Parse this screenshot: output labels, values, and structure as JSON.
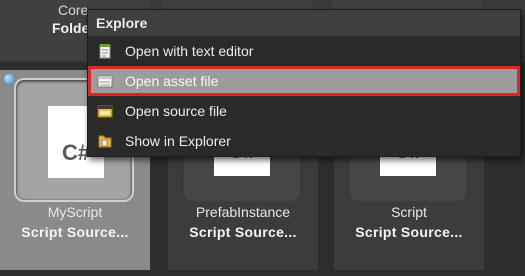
{
  "top_row": [
    {
      "name": "Core",
      "type": "Folde"
    },
    {
      "name": "",
      "type": ""
    },
    {
      "name": "",
      "type": ""
    }
  ],
  "assets": [
    {
      "name": "MyScript",
      "type": "Script Source...",
      "icon_text": "C#",
      "selected": true
    },
    {
      "name": "PrefabInstance",
      "type": "Script Source...",
      "icon_text": "C#",
      "selected": false
    },
    {
      "name": "Script",
      "type": "Script Source...",
      "icon_text": "C#",
      "selected": false
    }
  ],
  "context_menu": {
    "title": "Explore",
    "items": [
      {
        "label": "Open with text editor",
        "icon": "notepad-icon"
      },
      {
        "label": "Open asset file",
        "icon": "document-icon",
        "highlighted": true
      },
      {
        "label": "Open source file",
        "icon": "source-file-icon"
      },
      {
        "label": "Show in Explorer",
        "icon": "folder-icon"
      }
    ]
  },
  "colors": {
    "menu_bg": "#2a2a2a",
    "highlight_bg": "#9c9c9c",
    "highlight_border": "#d62a2a",
    "selected_tile": "#8a8a8a"
  }
}
